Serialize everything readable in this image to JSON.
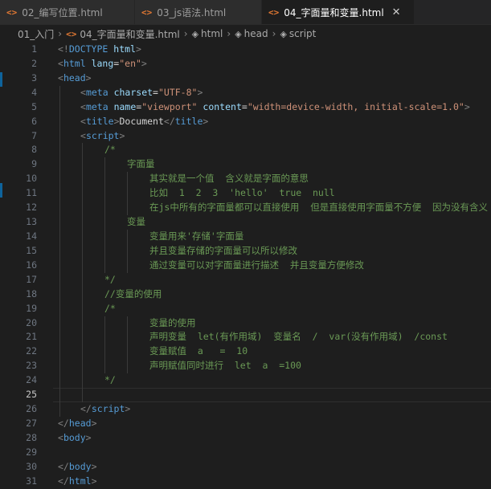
{
  "tabs": [
    {
      "icon": "<>",
      "label": "02_编写位置.html",
      "active": false
    },
    {
      "icon": "<>",
      "label": "03_js语法.html",
      "active": false
    },
    {
      "icon": "<>",
      "label": "04_字面量和变量.html",
      "active": true,
      "close": "✕"
    }
  ],
  "breadcrumb": {
    "folder": "01_入门",
    "file": "04_字面量和变量.html",
    "nodes": [
      "html",
      "head",
      "script"
    ]
  },
  "editor": {
    "current_line": 25,
    "lines": [
      {
        "n": "1"
      },
      {
        "n": "2"
      },
      {
        "n": "3"
      },
      {
        "n": "4"
      },
      {
        "n": "5"
      },
      {
        "n": "6"
      },
      {
        "n": "7"
      },
      {
        "n": "8"
      },
      {
        "n": "9"
      },
      {
        "n": "10"
      },
      {
        "n": "11"
      },
      {
        "n": "12"
      },
      {
        "n": "13"
      },
      {
        "n": "14"
      },
      {
        "n": "15"
      },
      {
        "n": "16"
      },
      {
        "n": "17"
      },
      {
        "n": "18"
      },
      {
        "n": "19"
      },
      {
        "n": "20"
      },
      {
        "n": "21"
      },
      {
        "n": "22"
      },
      {
        "n": "23"
      },
      {
        "n": "24"
      },
      {
        "n": "25"
      },
      {
        "n": "26"
      },
      {
        "n": "27"
      },
      {
        "n": "28"
      },
      {
        "n": "29"
      },
      {
        "n": "30"
      },
      {
        "n": "31"
      }
    ],
    "text": {
      "doctype": "DOCTYPE",
      "html_kw": "html",
      "lang_attr": "lang",
      "lang_val": "\"en\"",
      "head": "head",
      "meta": "meta",
      "charset_attr": "charset",
      "charset_val": "\"UTF-8\"",
      "name_attr": "name",
      "name_val": "\"viewport\"",
      "content_attr": "content",
      "content_val": "\"width=device-width, initial-scale=1.0\"",
      "title": "title",
      "title_text": "Document",
      "script": "script",
      "body": "body",
      "c8": "/*",
      "c9": "字面量",
      "c10": "其实就是一个值  含义就是字面的意思",
      "c11": "比如  1  2  3  'hello'  true  null",
      "c12": "在js中所有的字面量都可以直接使用  但是直接使用字面量不方便  因为没有含义",
      "c13": "变量",
      "c14": "变量用来'存储'字面量",
      "c15": "并且变量存储的字面量可以所以修改",
      "c16": "通过变量可以对字面量进行描述  并且变量方便修改",
      "c17": "*/",
      "c18": "//变量的使用",
      "c19": "/*",
      "c20": "变量的使用",
      "c21": "声明变量  let(有作用域)  变量名  /  var(没有作用域)  /const",
      "c22": "变量赋值  a   =  10",
      "c23": "声明赋值同时进行  let  a  =100",
      "c24": "*/"
    }
  },
  "colors": {
    "background": "#1e1e1e",
    "tag": "#569cd6",
    "attribute": "#9cdcfe",
    "string": "#ce9178",
    "comment": "#6a9955",
    "file_icon": "#e37933"
  }
}
